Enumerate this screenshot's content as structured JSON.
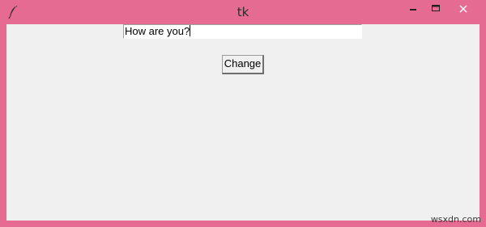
{
  "window": {
    "title": "tk"
  },
  "entry": {
    "value": "How are you?"
  },
  "button": {
    "label": "Change"
  },
  "watermark": {
    "text": "wsxdn.com"
  },
  "colors": {
    "titlebar": "#e66b93",
    "client": "#f0f0f0",
    "close_button": "#e66b93"
  },
  "icons": [
    "feather-icon",
    "minimize-icon",
    "maximize-icon",
    "close-icon"
  ]
}
